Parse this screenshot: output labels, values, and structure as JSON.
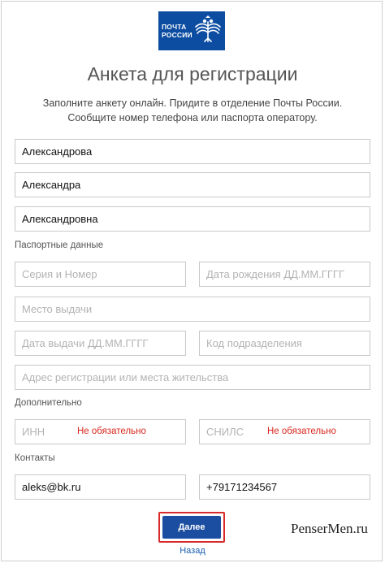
{
  "logo": {
    "line1": "ПОЧТА",
    "line2": "РОССИИ"
  },
  "title": "Анкета для регистрации",
  "intro": {
    "line1": "Заполните анкету онлайн. Придите в отделение Почты России.",
    "line2": "Сообщите номер телефона или паспорта оператору."
  },
  "name": {
    "last_name": "Александрова",
    "first_name": "Александра",
    "patronymic": "Александровна"
  },
  "passport": {
    "label": "Паспортные данные",
    "series_number_placeholder": "Серия и Номер",
    "birth_date_placeholder": "Дата рождения ДД.ММ.ГГГГ",
    "issue_place_placeholder": "Место выдачи",
    "issue_date_placeholder": "Дата выдачи ДД.ММ.ГГГГ",
    "division_code_placeholder": "Код подразделения",
    "address_placeholder": "Адрес регистрации или места жительства"
  },
  "additional": {
    "label": "Дополнительно",
    "inn_placeholder": "ИНН",
    "inn_optional": "Не обязательно",
    "snils_placeholder": "СНИЛС",
    "snils_optional": "Не обязательно"
  },
  "contacts": {
    "label": "Контакты",
    "email": "aleks@bk.ru",
    "phone": "+79171234567"
  },
  "actions": {
    "next_label": "Далее",
    "back_label": "Назад"
  },
  "watermark": "PenserMen.ru",
  "colors": {
    "brand_blue": "#0c4da2",
    "button_blue": "#1b4ea0",
    "highlight_red": "#d82a2a",
    "optional_red": "#d8281f",
    "link_blue": "#1b5fb0"
  }
}
